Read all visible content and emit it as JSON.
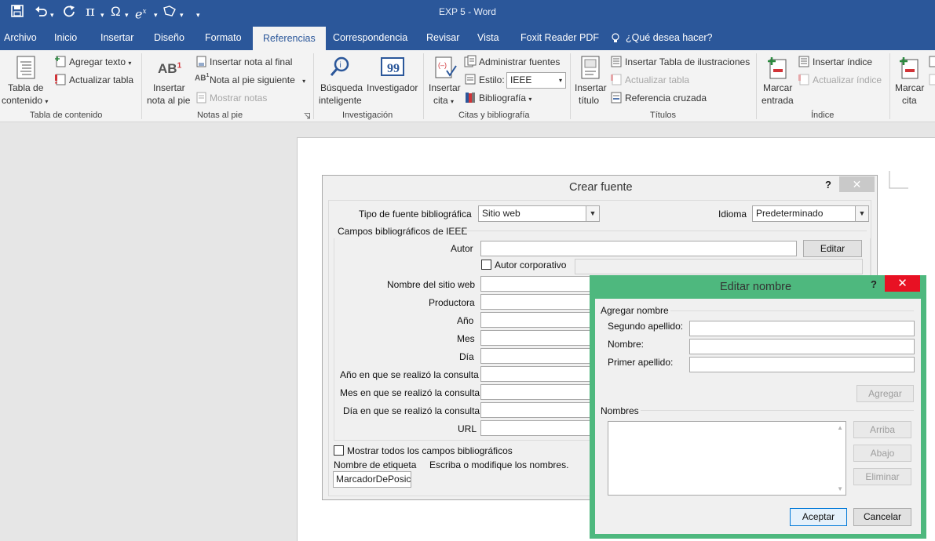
{
  "window": {
    "title": "EXP 5  -  Word"
  },
  "quick_access": [
    "save-icon",
    "undo-icon",
    "redo-icon",
    "pi-icon",
    "omega-icon",
    "ex-icon",
    "shape-icon",
    "customize-icon"
  ],
  "tabs": [
    "Archivo",
    "Inicio",
    "Insertar",
    "Diseño",
    "Formato",
    "Referencias",
    "Correspondencia",
    "Revisar",
    "Vista",
    "Foxit Reader PDF",
    "¿Qué desea hacer?"
  ],
  "ribbon": {
    "toc": {
      "big_line1": "Tabla de",
      "big_line2": "contenido",
      "add_text": "Agregar texto",
      "update_table": "Actualizar tabla",
      "group": "Tabla de contenido"
    },
    "footnotes": {
      "big_line1": "Insertar",
      "big_line2": "nota al pie",
      "insert_endnote": "Insertar nota al final",
      "next_footnote": "Nota al pie siguiente",
      "show_notes": "Mostrar notas",
      "group": "Notas al pie"
    },
    "research": {
      "smart_line1": "Búsqueda",
      "smart_line2": "inteligente",
      "researcher": "Investigador",
      "group": "Investigación"
    },
    "citations": {
      "insert_line1": "Insertar",
      "insert_line2": "cita",
      "manage_sources": "Administrar fuentes",
      "style_label": "Estilo:",
      "style_value": "IEEE",
      "bibliography": "Bibliografía",
      "group": "Citas y bibliografía"
    },
    "captions": {
      "insert_line1": "Insertar",
      "insert_line2": "título",
      "insert_table_fig": "Insertar Tabla de ilustraciones",
      "update_table": "Actualizar tabla",
      "cross_ref": "Referencia cruzada",
      "group": "Títulos"
    },
    "index": {
      "mark_line1": "Marcar",
      "mark_line2": "entrada",
      "insert_index": "Insertar índice",
      "update_index": "Actualizar índice",
      "group": "Índice"
    },
    "toa": {
      "mark_line1": "Marcar",
      "mark_line2": "cita"
    }
  },
  "create_source": {
    "title": "Crear fuente",
    "help": "?",
    "close": "✕",
    "type_label": "Tipo de fuente bibliográfica",
    "type_value": "Sitio web",
    "lang_label": "Idioma",
    "lang_value": "Predeterminado",
    "fields_group": "Campos bibliográficos de IEEE",
    "author_label": "Autor",
    "author_value": "",
    "edit_button": "Editar",
    "corporate_label": "Autor corporativo",
    "site_name": "Nombre del sitio web",
    "producer": "Productora",
    "year": "Año",
    "month": "Mes",
    "day": "Día",
    "year_accessed": "Año en que se realizó la consulta",
    "month_accessed": "Mes en que se realizó la consulta",
    "day_accessed": "Día en que se realizó la consulta",
    "url": "URL",
    "show_all": "Mostrar todos los campos bibliográficos",
    "tag_label": "Nombre de etiqueta",
    "tag_value": "MarcadorDePosición",
    "hint": "Escriba o modifique los nombres."
  },
  "edit_name": {
    "title": "Editar nombre",
    "help": "?",
    "close": "✕",
    "add_group": "Agregar nombre",
    "second_surname": "Segundo apellido:",
    "first_name": "Nombre:",
    "first_surname": "Primer apellido:",
    "add_button": "Agregar",
    "names_group": "Nombres",
    "up_button": "Arriba",
    "down_button": "Abajo",
    "delete_button": "Eliminar",
    "ok_button": "Aceptar",
    "cancel_button": "Cancelar"
  },
  "colors": {
    "word_blue": "#2b579a",
    "dialog_green": "#4eb87e",
    "close_red": "#e81123"
  }
}
